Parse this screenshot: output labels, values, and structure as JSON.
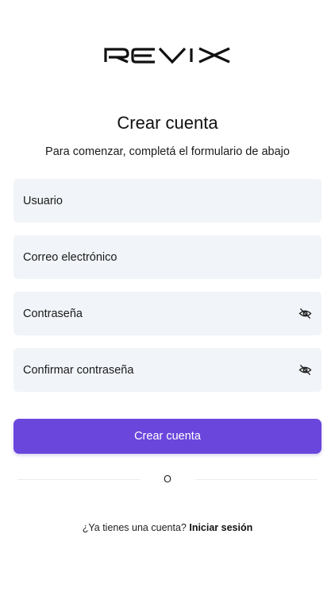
{
  "brand": {
    "logo_text": "REVIX"
  },
  "header": {
    "title": "Crear cuenta",
    "subtitle": "Para comenzar, completá el formulario de abajo"
  },
  "form": {
    "username": {
      "placeholder": "Usuario",
      "value": ""
    },
    "email": {
      "placeholder": "Correo electrónico",
      "value": ""
    },
    "password": {
      "placeholder": "Contraseña",
      "value": "",
      "toggle_icon": "eye-off-icon"
    },
    "confirm_password": {
      "placeholder": "Confirmar contraseña",
      "value": "",
      "toggle_icon": "eye-off-icon"
    },
    "submit_label": "Crear cuenta"
  },
  "divider": {
    "text": "O"
  },
  "footer": {
    "prompt": "¿Ya tienes una cuenta?",
    "login_link": "Iniciar sesión"
  },
  "colors": {
    "accent": "#6a46dd",
    "field_background": "#f1f4f8",
    "text": "#111111"
  }
}
